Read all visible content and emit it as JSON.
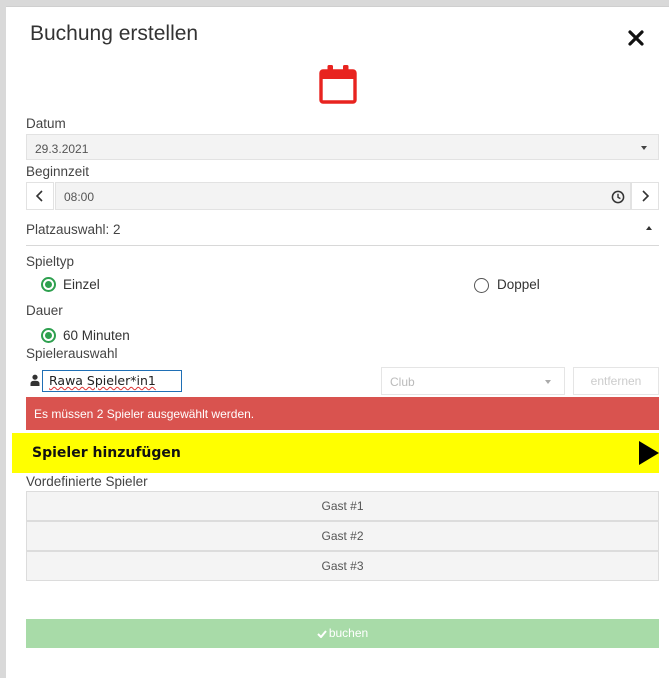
{
  "dialog": {
    "title": "Buchung erstellen"
  },
  "date": {
    "label": "Datum",
    "value": "29.3.2021"
  },
  "start_time": {
    "label": "Beginnzeit",
    "value": "08:00",
    "prev_label": "‹",
    "next_label": "›"
  },
  "court_selection": {
    "label": "Platzauswahl: 2"
  },
  "game_type": {
    "label": "Spieltyp",
    "options": [
      "Einzel",
      "Doppel"
    ],
    "selected": "Einzel"
  },
  "duration": {
    "label": "Dauer",
    "options": [
      "60 Minuten"
    ],
    "selected": "60 Minuten"
  },
  "player_selection": {
    "label": "Spielerauswahl",
    "player_name": "Rawa Spieler*in1",
    "club_placeholder": "Club",
    "remove_label": "entfernen"
  },
  "alert": {
    "message": "Es müssen 2 Spieler ausgewählt werden.",
    "color": "#d9534f"
  },
  "add_player": {
    "label": "Spieler hinzufügen",
    "color": "#ffff00"
  },
  "predefined": {
    "label": "Vordefinierte Spieler",
    "guests": [
      "Gast #1",
      "Gast #2",
      "Gast #3"
    ]
  },
  "book_button": {
    "label": "buchen",
    "color": "#a8dba8"
  },
  "accent_color": "#2ea04f",
  "calendar_icon_color": "#e8231f"
}
